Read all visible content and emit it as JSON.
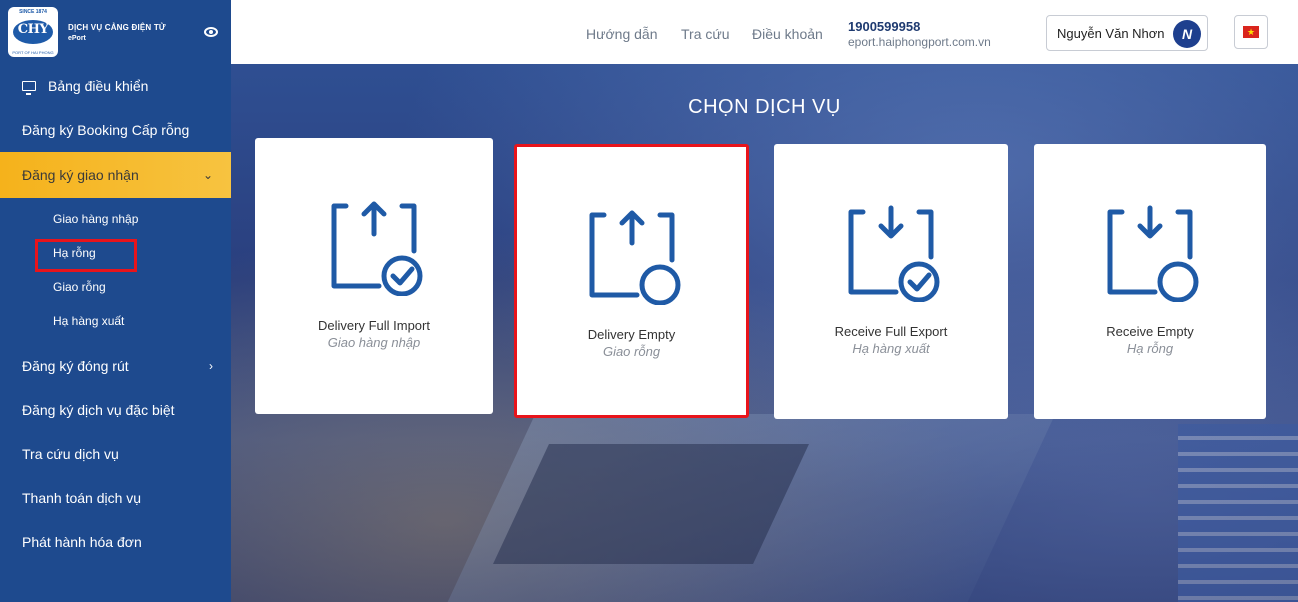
{
  "app": {
    "logo_top": "SINCE 1874",
    "logo_mark": "CHY",
    "logo_bottom": "PORT OF HAI PHONG",
    "title": "DỊCH VỤ CẢNG ĐIỆN TỬ",
    "subtitle": "ePort"
  },
  "sidebar": {
    "items": [
      {
        "label": "Bảng điều khiển"
      },
      {
        "label": "Đăng ký Booking Cấp rỗng"
      },
      {
        "label": "Đăng ký giao nhận",
        "chevron": "⌄"
      },
      {
        "label": "Đăng ký đóng rút",
        "chevron": "›"
      },
      {
        "label": "Đăng ký dịch vụ đặc biệt"
      },
      {
        "label": "Tra cứu dịch vụ"
      },
      {
        "label": "Thanh toán dịch vụ"
      },
      {
        "label": "Phát hành hóa đơn"
      }
    ],
    "submenu": [
      {
        "label": "Giao hàng nhập"
      },
      {
        "label": "Hạ rỗng"
      },
      {
        "label": "Giao rỗng"
      },
      {
        "label": "Hạ hàng xuất"
      }
    ]
  },
  "header": {
    "nav": [
      "Hướng dẫn",
      "Tra cứu",
      "Điều khoản"
    ],
    "phone": "1900599958",
    "website": "eport.haiphongport.com.vn",
    "user_name": "Nguyễn Văn Nhơn",
    "avatar_initial": "N",
    "flag_star": "★"
  },
  "main": {
    "title": "CHỌN DỊCH VỤ",
    "cards": [
      {
        "title": "Delivery Full Import",
        "subtitle": "Giao hàng nhập",
        "icon": "upload-check-icon"
      },
      {
        "title": "Delivery Empty",
        "subtitle": "Giao rỗng",
        "icon": "upload-empty-icon"
      },
      {
        "title": "Receive Full Export",
        "subtitle": "Hạ hàng xuất",
        "icon": "download-check-icon"
      },
      {
        "title": "Receive Empty",
        "subtitle": "Hạ rỗng",
        "icon": "download-empty-icon"
      }
    ]
  },
  "colors": {
    "sidebar_bg": "#1e4a8e",
    "active_item": "#f5b21b",
    "highlight_red": "#e8141b",
    "icon_blue": "#1f5aa6"
  }
}
